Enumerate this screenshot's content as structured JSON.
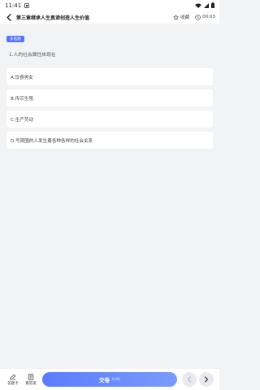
{
  "status_bar": {
    "time": "11:41",
    "icons": [
      "notification-icon",
      "wifi-icon",
      "signal-icon",
      "battery-icon"
    ]
  },
  "header": {
    "title": "第三章继承人生真谛创造人生价值",
    "favorite_label": "收藏",
    "timer": "00:03",
    "icons": [
      "back-arrow-icon",
      "star-icon",
      "clock-icon"
    ]
  },
  "question": {
    "type_badge": "多选题",
    "text": "1.人的社会属性体现在",
    "options": [
      "A.饮食男女",
      "B.传宗生殖",
      "C.生产劳动",
      "D.写周围的人发生着各种各样的社会关系"
    ]
  },
  "bottom_bar": {
    "answer_card_label": "答题卡",
    "notes_label": "看答案",
    "submit_label": "交卷",
    "submit_sub": "0/40",
    "icons": [
      "edit-icon",
      "book-icon",
      "chevron-left-icon",
      "chevron-right-icon"
    ]
  },
  "colors": {
    "accent": "#4f74ff",
    "background": "#f2f3f5",
    "card": "#ffffff"
  }
}
